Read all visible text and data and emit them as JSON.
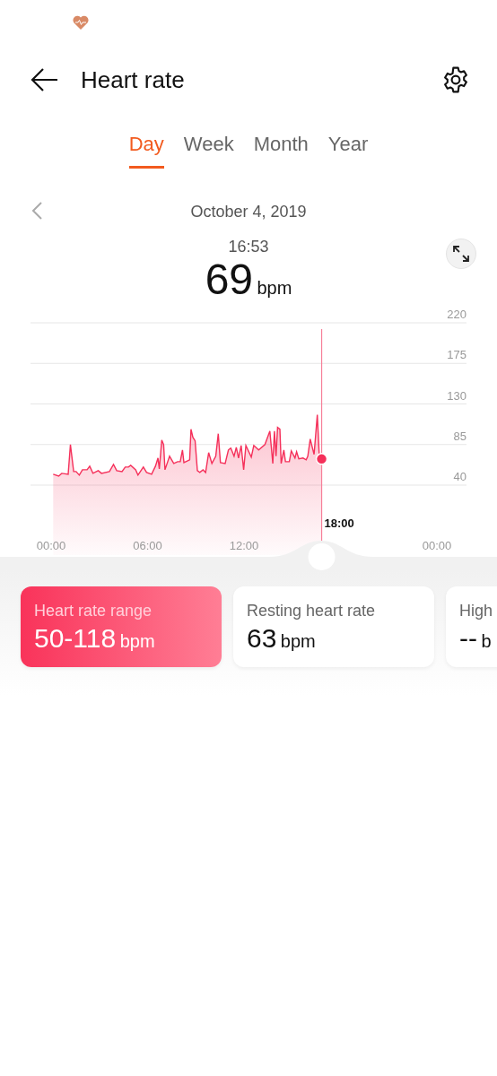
{
  "header": {
    "title": "Heart rate"
  },
  "tabs": [
    {
      "label": "Day",
      "selected": true
    },
    {
      "label": "Week",
      "selected": false
    },
    {
      "label": "Month",
      "selected": false
    },
    {
      "label": "Year",
      "selected": false
    }
  ],
  "date": "October 4, 2019",
  "reading": {
    "time": "16:53",
    "value": "69",
    "unit": "bpm"
  },
  "chart": {
    "cursor_label": "18:00",
    "chart_data": {
      "type": "area",
      "grid": true,
      "ref_lines": [
        {
          "axis": "x",
          "value": 16.83,
          "color": "#f77f98"
        }
      ],
      "xlim": [
        0,
        24
      ],
      "ylim": [
        40,
        220
      ],
      "xticks": [
        {
          "value": 0,
          "label": "00:00"
        },
        {
          "value": 6,
          "label": "06:00"
        },
        {
          "value": 12,
          "label": "12:00"
        },
        {
          "value": 24,
          "label": "00:00"
        }
      ],
      "yticks": [
        40,
        85,
        130,
        175,
        220
      ],
      "x": [
        0.13,
        0.47,
        0.66,
        1.06,
        1.2,
        1.4,
        1.55,
        1.75,
        1.95,
        2.24,
        2.4,
        2.6,
        2.93,
        3.13,
        3.63,
        3.88,
        4.08,
        4.41,
        4.61,
        4.81,
        4.95,
        5.26,
        5.4,
        5.74,
        5.94,
        6.25,
        6.49,
        6.65,
        6.73,
        6.88,
        7.0,
        7.08,
        7.37,
        7.63,
        7.87,
        8.03,
        8.17,
        8.26,
        8.62,
        8.7,
        8.82,
        8.96,
        9.1,
        9.25,
        9.45,
        9.61,
        9.8,
        10.0,
        10.24,
        10.4,
        10.53,
        10.83,
        11.03,
        11.18,
        11.38,
        11.52,
        11.66,
        11.82,
        11.98,
        12.12,
        12.45,
        12.61,
        12.91,
        13.3,
        13.61,
        13.79,
        13.89,
        13.99,
        14.09,
        14.23,
        14.31,
        14.48,
        14.58,
        14.82,
        14.94,
        15.17,
        15.27,
        15.41,
        15.67,
        15.87,
        15.97,
        16.12,
        16.36,
        16.56,
        16.68,
        16.83
      ],
      "series": [
        {
          "color": "#f5305a",
          "values": [
            52,
            50,
            53,
            52,
            85,
            55,
            55,
            51,
            57,
            57,
            61,
            53,
            56,
            53,
            55,
            63,
            56,
            55,
            60,
            60,
            62,
            57,
            51,
            60,
            54,
            52,
            61,
            70,
            58,
            90,
            85,
            57,
            72,
            64,
            66,
            66,
            79,
            65,
            68,
            102,
            93,
            89,
            56,
            54,
            57,
            54,
            76,
            64,
            72,
            97,
            65,
            64,
            79,
            81,
            72,
            82,
            70,
            84,
            57,
            84,
            71,
            84,
            79,
            85,
            100,
            64,
            100,
            72,
            104,
            102,
            64,
            79,
            66,
            66,
            78,
            70,
            77,
            69,
            70,
            68,
            72,
            91,
            74,
            118,
            72,
            69
          ]
        }
      ]
    }
  },
  "cards": [
    {
      "title": "Heart rate range",
      "value": "50-118",
      "unit": "bpm",
      "selected": true
    },
    {
      "title": "Resting heart rate",
      "value": "63",
      "unit": "bpm",
      "selected": false
    },
    {
      "title": "High",
      "value": "--",
      "unit": "b",
      "selected": false
    }
  ]
}
